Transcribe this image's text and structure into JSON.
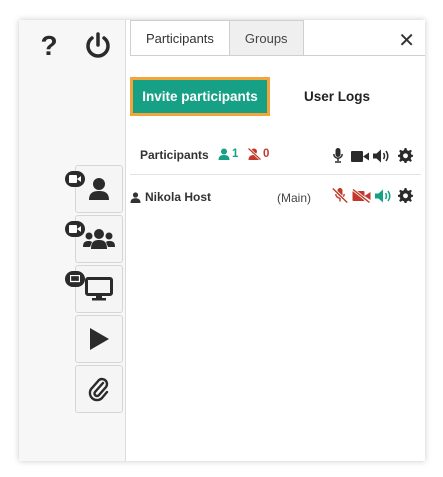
{
  "tabs": [
    {
      "label": "Participants",
      "active": true
    },
    {
      "label": "Groups",
      "active": false
    }
  ],
  "actions": {
    "invite_label": "Invite participants",
    "userlogs_label": "User Logs"
  },
  "participants_header": {
    "label": "Participants",
    "online_count": "1",
    "offline_count": "0"
  },
  "participants": [
    {
      "name": "Nikola Host",
      "room": "(Main)"
    }
  ],
  "sidebar": {
    "top_icons": [
      "help-icon",
      "power-icon"
    ],
    "buttons": [
      "user-video-icon",
      "group-video-icon",
      "screen-share-icon",
      "play-icon",
      "attachment-icon"
    ]
  },
  "colors": {
    "accent": "#16a085",
    "highlight_border": "#f3a53b",
    "muted_red": "#c0392b",
    "online_green": "#16a085"
  }
}
